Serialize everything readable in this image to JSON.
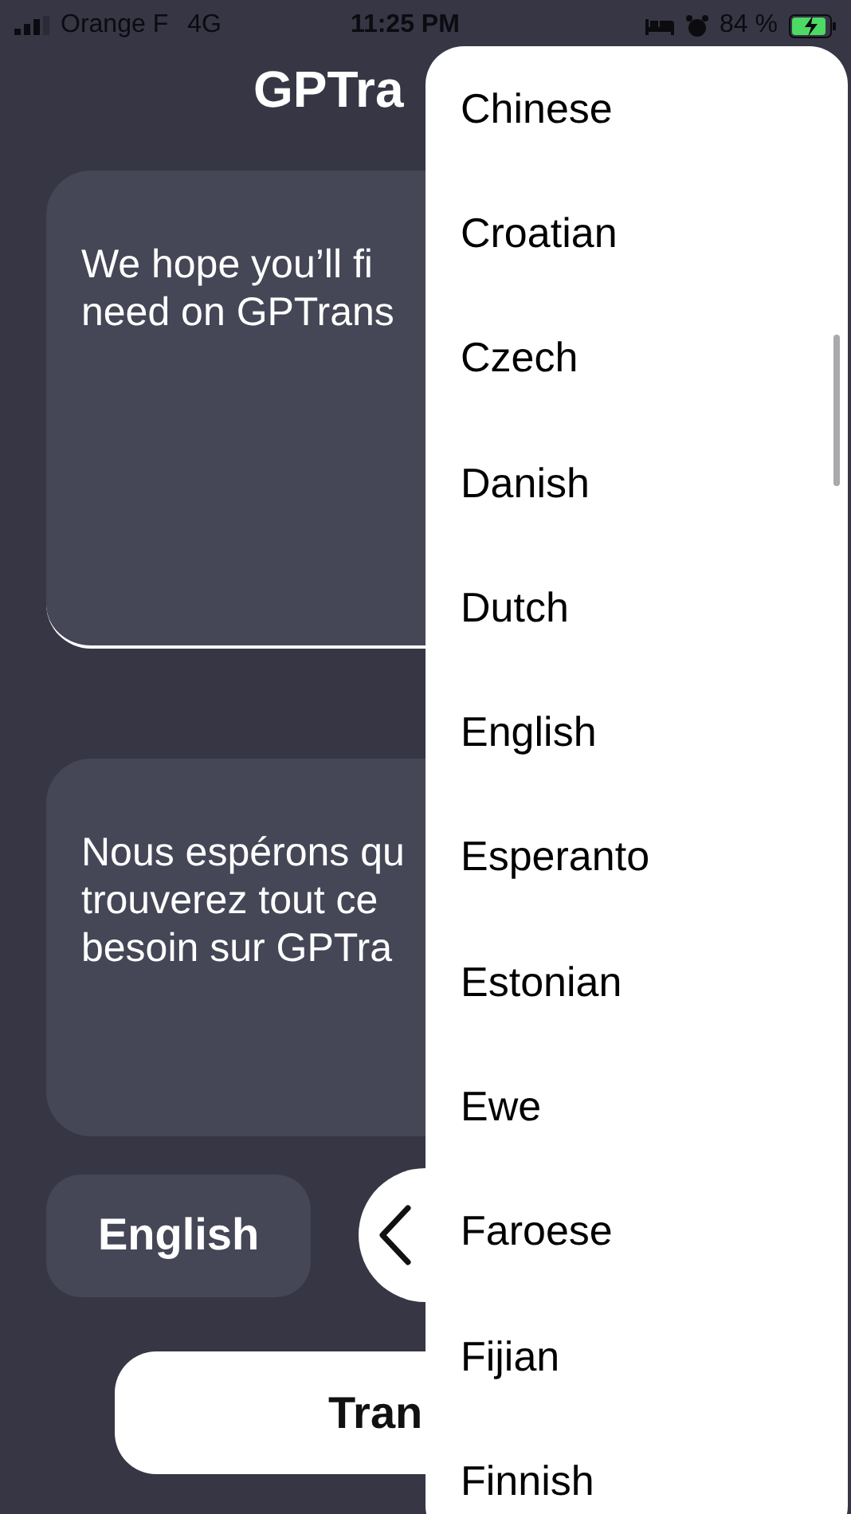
{
  "status_bar": {
    "carrier": "Orange F",
    "network": "4G",
    "time": "11:25 PM",
    "battery": "84 %"
  },
  "title": "GPTra",
  "source_text": [
    "We hope you’ll fi",
    "need on GPTrans"
  ],
  "target_text": [
    "Nous espérons qu",
    "trouverez tout ce",
    "besoin sur GPTra"
  ],
  "source_language": "English",
  "translate_button": "Tran",
  "language_menu": {
    "items": [
      {
        "label": "Chinese"
      },
      {
        "label": "Croatian"
      },
      {
        "label": "Czech"
      },
      {
        "label": "Danish"
      },
      {
        "label": "Dutch"
      },
      {
        "label": "English"
      },
      {
        "label": "Esperanto"
      },
      {
        "label": "Estonian"
      },
      {
        "label": "Ewe"
      },
      {
        "label": "Faroese"
      },
      {
        "label": "Fijian"
      },
      {
        "label": "Finnish"
      }
    ]
  }
}
